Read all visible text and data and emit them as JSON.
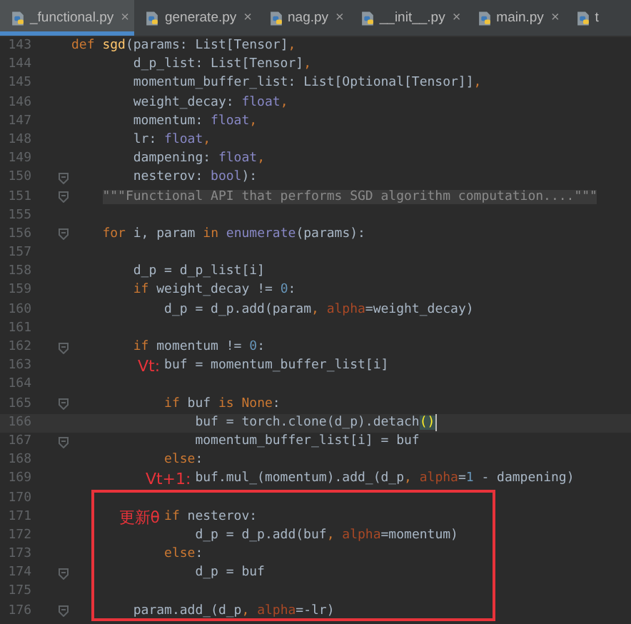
{
  "tabs": [
    {
      "label": "_functional.py",
      "selected": true,
      "closable": true
    },
    {
      "label": "generate.py",
      "selected": false,
      "closable": true
    },
    {
      "label": "nag.py",
      "selected": false,
      "closable": true
    },
    {
      "label": "__init__.py",
      "selected": false,
      "closable": true
    },
    {
      "label": "main.py",
      "selected": false,
      "closable": true
    },
    {
      "label": "t",
      "selected": false,
      "closable": false
    }
  ],
  "close_glyph": "×",
  "blocks": [
    {
      "boxed": false,
      "lines": [
        {
          "number": "143",
          "fold": false,
          "current": false,
          "segments": [
            {
              "text": "def ",
              "kind": "keyword"
            },
            {
              "text": "sgd",
              "kind": "function"
            },
            {
              "text": "(params: List[Tensor]",
              "kind": "plain"
            },
            {
              "text": ",",
              "kind": "keyword"
            }
          ]
        },
        {
          "number": "144",
          "fold": false,
          "current": false,
          "segments": [
            {
              "text": "        d_p_list: List[Tensor]",
              "kind": "plain"
            },
            {
              "text": ",",
              "kind": "keyword"
            }
          ]
        },
        {
          "number": "145",
          "fold": false,
          "current": false,
          "segments": [
            {
              "text": "        momentum_buffer_list: List[Optional[Tensor]]",
              "kind": "plain"
            },
            {
              "text": ",",
              "kind": "keyword"
            }
          ]
        },
        {
          "number": "146",
          "fold": false,
          "current": false,
          "segments": [
            {
              "text": "        weight_decay: ",
              "kind": "plain"
            },
            {
              "text": "float",
              "kind": "builtin"
            },
            {
              "text": ",",
              "kind": "keyword"
            }
          ]
        },
        {
          "number": "147",
          "fold": false,
          "current": false,
          "segments": [
            {
              "text": "        momentum: ",
              "kind": "plain"
            },
            {
              "text": "float",
              "kind": "builtin"
            },
            {
              "text": ",",
              "kind": "keyword"
            }
          ]
        },
        {
          "number": "148",
          "fold": false,
          "current": false,
          "segments": [
            {
              "text": "        lr: ",
              "kind": "plain"
            },
            {
              "text": "float",
              "kind": "builtin"
            },
            {
              "text": ",",
              "kind": "keyword"
            }
          ]
        },
        {
          "number": "149",
          "fold": false,
          "current": false,
          "segments": [
            {
              "text": "        dampening: ",
              "kind": "plain"
            },
            {
              "text": "float",
              "kind": "builtin"
            },
            {
              "text": ",",
              "kind": "keyword"
            }
          ]
        },
        {
          "number": "150",
          "fold": true,
          "current": false,
          "segments": [
            {
              "text": "        nesterov: ",
              "kind": "plain"
            },
            {
              "text": "bool",
              "kind": "builtin"
            },
            {
              "text": "):",
              "kind": "plain"
            }
          ]
        },
        {
          "number": "151",
          "fold": true,
          "current": false,
          "segments": [
            {
              "text": "    \"\"\"Functional API that performs SGD algorithm computation....\"\"\"",
              "kind": "folded"
            }
          ]
        },
        {
          "number": "155",
          "fold": false,
          "current": false
        },
        {
          "number": "156",
          "fold": true,
          "current": false,
          "segments": [
            {
              "text": "    for ",
              "kind": "keyword"
            },
            {
              "text": "i, param ",
              "kind": "plain"
            },
            {
              "text": "in ",
              "kind": "keyword"
            },
            {
              "text": "enumerate",
              "kind": "builtin"
            },
            {
              "text": "(params):",
              "kind": "plain"
            }
          ]
        },
        {
          "number": "157",
          "fold": false,
          "current": false
        },
        {
          "number": "158",
          "fold": false,
          "current": false,
          "segments": [
            {
              "text": "        d_p = d_p_list[i]",
              "kind": "plain"
            }
          ]
        },
        {
          "number": "159",
          "fold": false,
          "current": false,
          "segments": [
            {
              "text": "        if ",
              "kind": "keyword"
            },
            {
              "text": "weight_decay != ",
              "kind": "plain"
            },
            {
              "text": "0",
              "kind": "number"
            },
            {
              "text": ":",
              "kind": "plain"
            }
          ]
        },
        {
          "number": "160",
          "fold": false,
          "current": false,
          "segments": [
            {
              "text": "            d_p = d_p.add(param",
              "kind": "plain"
            },
            {
              "text": ", ",
              "kind": "keyword"
            },
            {
              "text": "alpha",
              "kind": "argname"
            },
            {
              "text": "=weight_decay)",
              "kind": "plain"
            }
          ]
        },
        {
          "number": "161",
          "fold": false,
          "current": false
        },
        {
          "number": "162",
          "fold": true,
          "current": false,
          "segments": [
            {
              "text": "        if ",
              "kind": "keyword"
            },
            {
              "text": "momentum != ",
              "kind": "plain"
            },
            {
              "text": "0",
              "kind": "number"
            },
            {
              "text": ":",
              "kind": "plain"
            }
          ]
        },
        {
          "number": "163",
          "fold": false,
          "current": false,
          "annotation": "Vt:",
          "segments": [
            {
              "text": "            buf = momentum_buffer_list[i]",
              "kind": "plain"
            }
          ]
        },
        {
          "number": "164",
          "fold": false,
          "current": false
        },
        {
          "number": "165",
          "fold": true,
          "current": false,
          "segments": [
            {
              "text": "            if ",
              "kind": "keyword"
            },
            {
              "text": "buf ",
              "kind": "plain"
            },
            {
              "text": "is None",
              "kind": "keyword"
            },
            {
              "text": ":",
              "kind": "plain"
            }
          ]
        },
        {
          "number": "166",
          "fold": false,
          "current": true,
          "segments": [
            {
              "text": "                buf = torch.clone(d_p).detach",
              "kind": "plain"
            },
            {
              "text": "()",
              "kind": "matched"
            }
          ]
        },
        {
          "number": "167",
          "fold": true,
          "current": false,
          "segments": [
            {
              "text": "                momentum_buffer_list[i] = buf",
              "kind": "plain"
            }
          ]
        },
        {
          "number": "168",
          "fold": false,
          "current": false,
          "segments": [
            {
              "text": "            else",
              "kind": "keyword"
            },
            {
              "text": ":",
              "kind": "plain"
            }
          ]
        },
        {
          "number": "169",
          "fold": false,
          "current": false,
          "annotation": "Vt+1:",
          "segments": [
            {
              "text": "                buf.mul_(momentum).add_(d_p",
              "kind": "plain"
            },
            {
              "text": ", ",
              "kind": "keyword"
            },
            {
              "text": "alpha",
              "kind": "argname"
            },
            {
              "text": "=",
              "kind": "plain"
            },
            {
              "text": "1",
              "kind": "number"
            },
            {
              "text": " - dampening)",
              "kind": "plain"
            }
          ]
        }
      ]
    },
    {
      "boxed": true,
      "lines": [
        {
          "number": "170",
          "fold": false,
          "current": false
        },
        {
          "number": "171",
          "fold": false,
          "current": false,
          "annotation": "更新θ",
          "segments": [
            {
              "text": "            if ",
              "kind": "keyword"
            },
            {
              "text": "nesterov:",
              "kind": "plain"
            }
          ]
        },
        {
          "number": "172",
          "fold": false,
          "current": false,
          "segments": [
            {
              "text": "                d_p = d_p.add(buf",
              "kind": "plain"
            },
            {
              "text": ", ",
              "kind": "keyword"
            },
            {
              "text": "alpha",
              "kind": "argname"
            },
            {
              "text": "=momentum)",
              "kind": "plain"
            }
          ]
        },
        {
          "number": "173",
          "fold": false,
          "current": false,
          "segments": [
            {
              "text": "            else",
              "kind": "keyword"
            },
            {
              "text": ":",
              "kind": "plain"
            }
          ]
        },
        {
          "number": "174",
          "fold": true,
          "current": false,
          "segments": [
            {
              "text": "                d_p = buf",
              "kind": "plain"
            }
          ]
        },
        {
          "number": "175",
          "fold": false,
          "current": false
        },
        {
          "number": "176",
          "fold": true,
          "current": false,
          "segments": [
            {
              "text": "        param.add_(d_p",
              "kind": "plain"
            },
            {
              "text": ", ",
              "kind": "keyword"
            },
            {
              "text": "alpha",
              "kind": "argname"
            },
            {
              "text": "=-lr)",
              "kind": "plain"
            }
          ]
        }
      ]
    }
  ]
}
